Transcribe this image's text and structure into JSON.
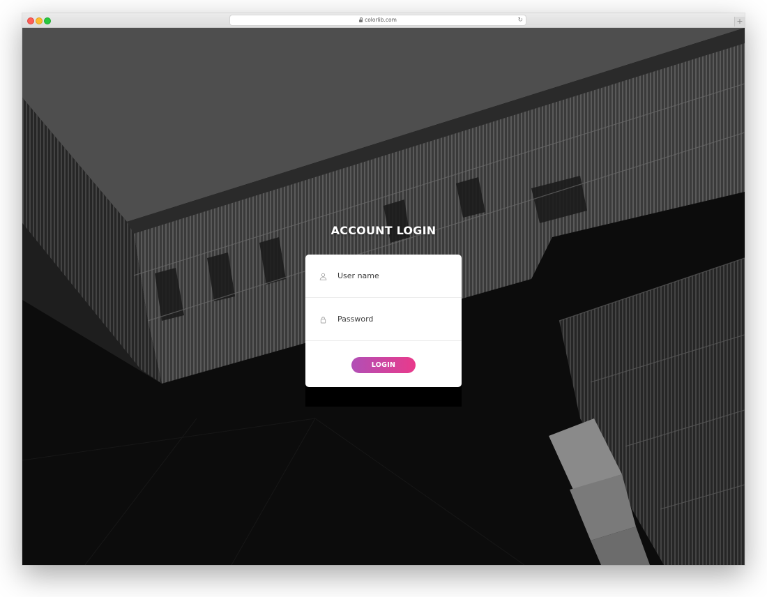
{
  "browser": {
    "url_display": "colorlib.com",
    "icons": {
      "lock": "lock-icon",
      "reload": "reload-icon",
      "new_tab": "plus-icon"
    },
    "traffic_light_colors": [
      "#fe5f57",
      "#febc2e",
      "#28c840"
    ]
  },
  "login": {
    "title": "ACCOUNT LOGIN",
    "username": {
      "placeholder": "User name",
      "value": "",
      "icon": "user-icon"
    },
    "password": {
      "placeholder": "Password",
      "value": "",
      "icon": "lock-icon"
    },
    "button_label": "LOGIN",
    "button_gradient": [
      "#b14fb6",
      "#e93a8b"
    ]
  }
}
